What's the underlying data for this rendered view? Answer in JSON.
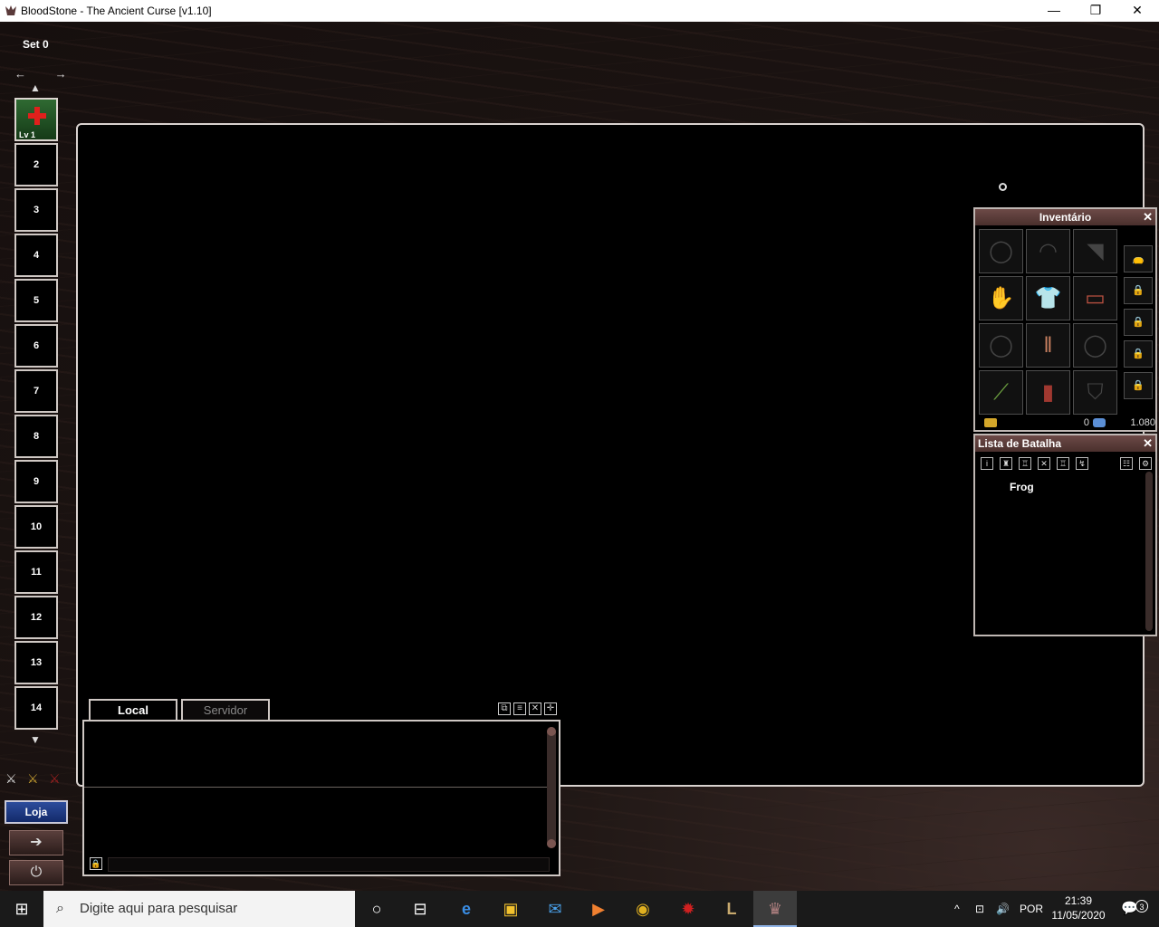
{
  "window": {
    "title": "BloodStone - The Ancient Curse [v1.10]",
    "controls": {
      "minimize": "—",
      "restore": "❐",
      "close": "✕"
    }
  },
  "hotbar": {
    "set_label": "Set 0",
    "set_arrows": "← →",
    "up_arrow": "▲",
    "down_arrow": "▼",
    "skill_slot": {
      "level": "Lv 1",
      "icon": "heal-cross-icon"
    },
    "slots": [
      "2",
      "3",
      "4",
      "5",
      "6",
      "7",
      "8",
      "9",
      "10",
      "11",
      "12",
      "13",
      "14"
    ]
  },
  "side_buttons": {
    "shop": "Loja",
    "enter": "➔",
    "power": "⏻",
    "mode_icons": [
      "⚔",
      "⚔",
      "⚔"
    ]
  },
  "chat": {
    "tabs": [
      "Local",
      "Servidor"
    ],
    "controls": [
      "⧉",
      "≡",
      "✕",
      "✛"
    ],
    "lock": "🔒"
  },
  "inventory": {
    "title": "Inventário",
    "close": "✕",
    "equipment_icons": [
      "necklace-icon",
      "helmet-icon",
      "cape-icon",
      "gloves-icon",
      "shirt-icon",
      "bracer-icon",
      "ring-icon",
      "pants-icon",
      "ring-icon",
      "bow-icon",
      "boots-icon",
      "shield-icon"
    ],
    "equipment_glyphs": [
      "◯",
      "◠",
      "◥",
      "✋",
      "👕",
      "▭",
      "◯",
      "‖",
      "◯",
      "⟋",
      "▮",
      "⛉"
    ],
    "bags": [
      "👝",
      "🔒",
      "🔒",
      "🔒",
      "🔒"
    ],
    "gold": "0",
    "gems": "1.080"
  },
  "battle_list": {
    "title": "Lista de Batalha",
    "close": "✕",
    "tools": [
      "i",
      "♜",
      "♖",
      "✕",
      "♖",
      "↯",
      "☷",
      "⚙"
    ],
    "entries": [
      "Frog"
    ]
  },
  "taskbar": {
    "search_placeholder": "Digite aqui para pesquisar",
    "language": "POR",
    "time": "21:39",
    "date": "11/05/2020",
    "notifications": "3",
    "apps": [
      "○",
      "⊟",
      "e",
      "▣",
      "✉",
      "▶",
      "◉",
      "✹",
      "L",
      "♛"
    ]
  }
}
